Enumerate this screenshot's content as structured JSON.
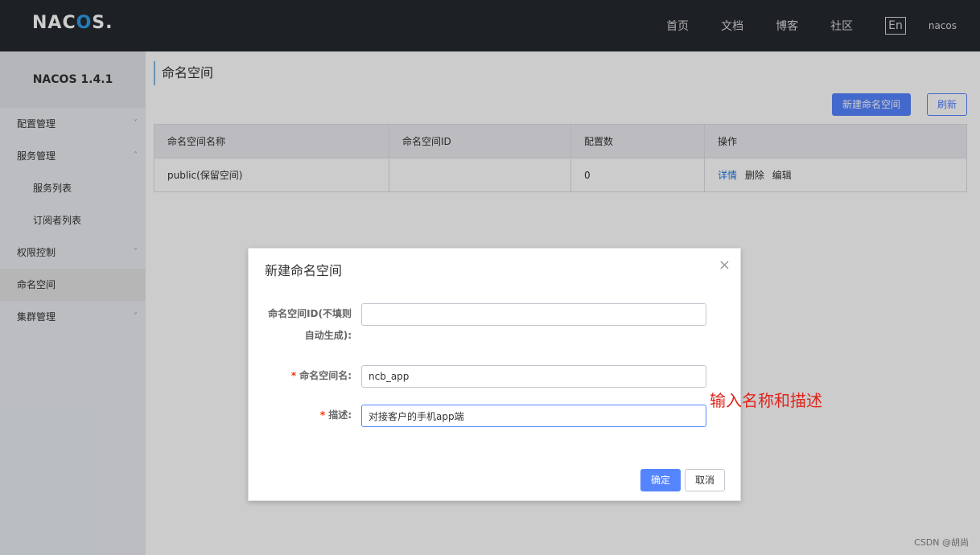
{
  "header": {
    "logo_left": "NAC",
    "logo_o": "O",
    "logo_right": "S.",
    "nav": [
      "首页",
      "文档",
      "博客",
      "社区"
    ],
    "lang": "En",
    "user": "nacos"
  },
  "sidebar": {
    "title": "NACOS 1.4.1",
    "items": [
      {
        "label": "配置管理",
        "chevron": "˅"
      },
      {
        "label": "服务管理",
        "chevron": "˄"
      },
      {
        "label": "服务列表"
      },
      {
        "label": "订阅者列表"
      },
      {
        "label": "权限控制",
        "chevron": "˅"
      },
      {
        "label": "命名空间"
      },
      {
        "label": "集群管理",
        "chevron": "˅"
      }
    ]
  },
  "main": {
    "title": "命名空间",
    "new_button": "新建命名空间",
    "refresh_button": "刷新",
    "table": {
      "headers": [
        "命名空间名称",
        "命名空间ID",
        "配置数",
        "操作"
      ],
      "rows": [
        {
          "name": "public(保留空间)",
          "id": "",
          "count": "0",
          "ops": [
            "详情",
            "删除",
            "编辑"
          ]
        }
      ]
    }
  },
  "dialog": {
    "title": "新建命名空间",
    "close": "×",
    "id_label_line1": "命名空间ID(不填则",
    "id_label_line2": "自动生成):",
    "id_value": "",
    "name_required": "*",
    "name_label": "命名空间名:",
    "name_value": "ncb_app",
    "desc_required": "*",
    "desc_label": "描述:",
    "desc_value": "对接客户的手机app端",
    "ok": "确定",
    "cancel": "取消"
  },
  "annotation": "输入名称和描述",
  "watermark": "CSDN @胡尚",
  "colors": {
    "header_bg": "#252a2f",
    "primary": "#5584ff",
    "link": "#2077e6",
    "required": "#ff3000",
    "annotation": "#e0241c"
  }
}
